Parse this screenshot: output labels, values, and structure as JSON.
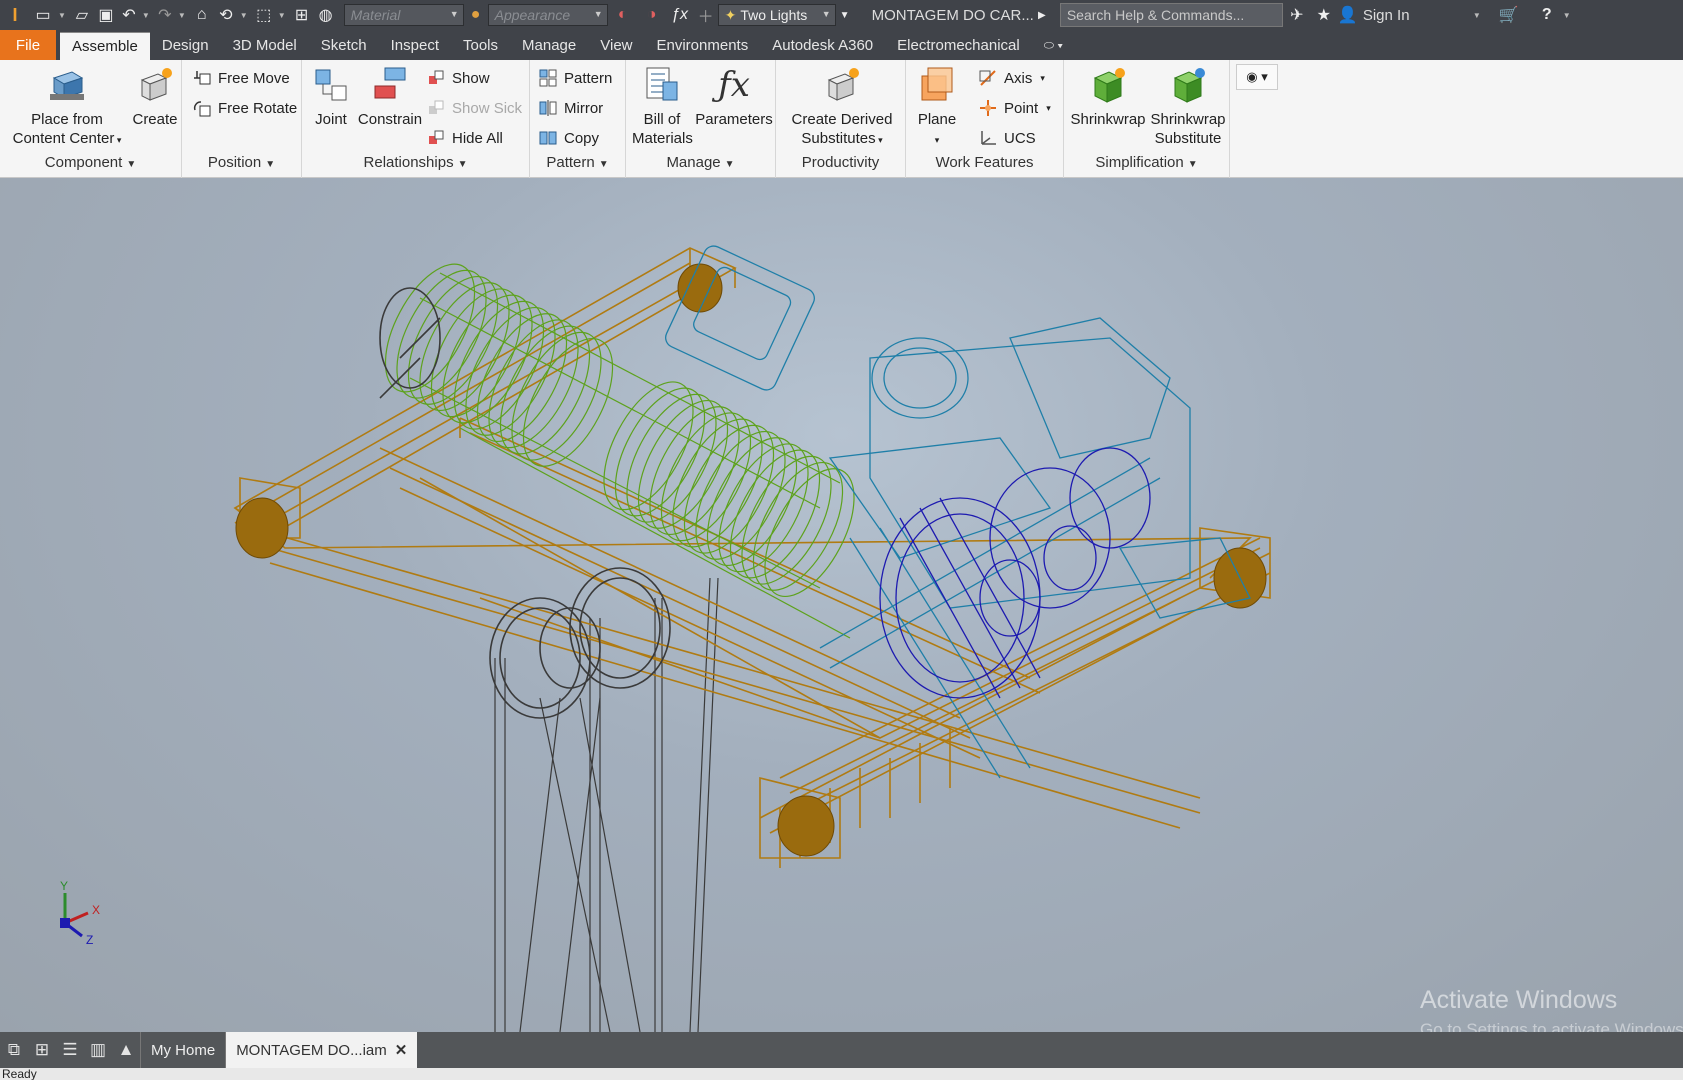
{
  "qat": {
    "app_icon": "inventor-logo-icon",
    "material_placeholder": "Material",
    "appearance_placeholder": "Appearance",
    "lighting_value": "Two Lights",
    "document_title": "MONTAGEM DO CAR...",
    "search_placeholder": "Search Help & Commands...",
    "sign_in": "Sign In"
  },
  "tabs": {
    "file": "File",
    "items": [
      "Assemble",
      "Design",
      "3D Model",
      "Sketch",
      "Inspect",
      "Tools",
      "Manage",
      "View",
      "Environments",
      "Autodesk A360",
      "Electromechanical"
    ]
  },
  "ribbon": {
    "component": {
      "label": "Component",
      "place_from": "Place from",
      "content_center": "Content Center",
      "create": "Create"
    },
    "position": {
      "label": "Position",
      "free_move": "Free Move",
      "free_rotate": "Free Rotate"
    },
    "relationships": {
      "label": "Relationships",
      "joint": "Joint",
      "constrain": "Constrain",
      "show": "Show",
      "show_sick": "Show Sick",
      "hide_all": "Hide All"
    },
    "pattern": {
      "label": "Pattern",
      "pattern": "Pattern",
      "mirror": "Mirror",
      "copy": "Copy"
    },
    "manage": {
      "label": "Manage",
      "bill_of": "Bill of",
      "materials": "Materials",
      "parameters": "Parameters"
    },
    "productivity": {
      "label": "Productivity",
      "create_derived": "Create Derived",
      "substitutes": "Substitutes"
    },
    "work_features": {
      "label": "Work Features",
      "plane": "Plane",
      "axis": "Axis",
      "point": "Point",
      "ucs": "UCS"
    },
    "simplification": {
      "label": "Simplification",
      "shrinkwrap": "Shrinkwrap",
      "shrinkwrap_sub1": "Shrinkwrap",
      "shrinkwrap_sub2": "Substitute"
    }
  },
  "viewport": {
    "triad": {
      "x": "X",
      "y": "Y",
      "z": "Z"
    },
    "watermark_title": "Activate Windows",
    "watermark_sub": "Go to Settings to activate Windows."
  },
  "doctabs": {
    "home": "My Home",
    "active_doc": "MONTAGEM DO...iam"
  },
  "status": "Ready",
  "colors": {
    "frame": "#b07b12",
    "drum": "#5da21d",
    "motor": "#1f7fa8",
    "gear": "#1d1ab0",
    "hook": "#3a3a3a",
    "file_tab": "#e8731c"
  }
}
